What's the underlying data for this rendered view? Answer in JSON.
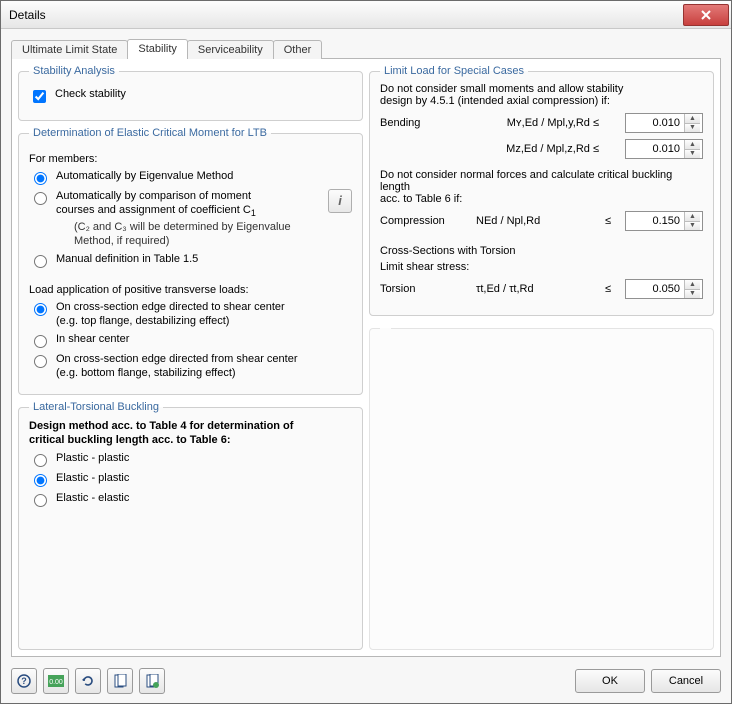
{
  "title": "Details",
  "tabs": {
    "uls": "Ultimate Limit State",
    "stability": "Stability",
    "serviceability": "Serviceability",
    "other": "Other"
  },
  "stability_analysis": {
    "legend": "Stability Analysis",
    "check_stability": "Check stability"
  },
  "ltb": {
    "legend": "Determination of Elastic Critical Moment for LTB",
    "for_members": "For members:",
    "opt_auto_eigen": "Automatically by Eigenvalue Method",
    "opt_auto_compare_line1": "Automatically by comparison of moment",
    "opt_auto_compare_line2": "courses and assignment of coefficient C",
    "opt_auto_compare_sub_line1": "(C₂ and C₃ will be determined by Eigenvalue",
    "opt_auto_compare_sub_line2": "Method, if required)",
    "opt_manual": "Manual definition in Table 1.5",
    "load_app_header": "Load application of positive transverse loads:",
    "opt_edge_to_sc_line1": "On cross-section edge directed to shear center",
    "opt_edge_to_sc_line2": "(e.g. top flange, destabilizing effect)",
    "opt_in_sc": "In shear center",
    "opt_edge_from_sc_line1": "On cross-section edge directed from shear center",
    "opt_edge_from_sc_line2": "(e.g. bottom flange, stabilizing effect)"
  },
  "ltb_buckling": {
    "legend": "Lateral-Torsional Buckling",
    "header_line1": "Design method acc. to Table 4 for determination of",
    "header_line2": "critical buckling length acc. to Table 6:",
    "opt_pp": "Plastic - plastic",
    "opt_ep": "Elastic - plastic",
    "opt_ee": "Elastic - elastic"
  },
  "limit": {
    "legend": "Limit Load for Special Cases",
    "note_line1": "Do not consider small moments and allow stability",
    "note_line2": "design by 4.5.1 (intended axial compression) if:",
    "bending_label": "Bending",
    "bending_ratio_y": "Mʏ,Ed / Mpl,y,Rd ≤",
    "bending_ratio_z": "Mᴢ,Ed / Mpl,z,Rd ≤",
    "bending_val_y": "0.010",
    "bending_val_z": "0.010",
    "comp_note_line1": "Do not consider normal forces and calculate critical buckling length",
    "comp_note_line2": "acc. to Table 6 if:",
    "compression_label": "Compression",
    "compression_ratio": "NEd / Npl,Rd",
    "compression_val": "0.150",
    "torsion_header": "Cross-Sections with Torsion",
    "torsion_note": "Limit shear stress:",
    "torsion_label": "Torsion",
    "torsion_ratio": "τt,Ed / τt,Rd",
    "torsion_val": "0.050",
    "leq": "≤"
  },
  "buttons": {
    "ok": "OK",
    "cancel": "Cancel"
  }
}
